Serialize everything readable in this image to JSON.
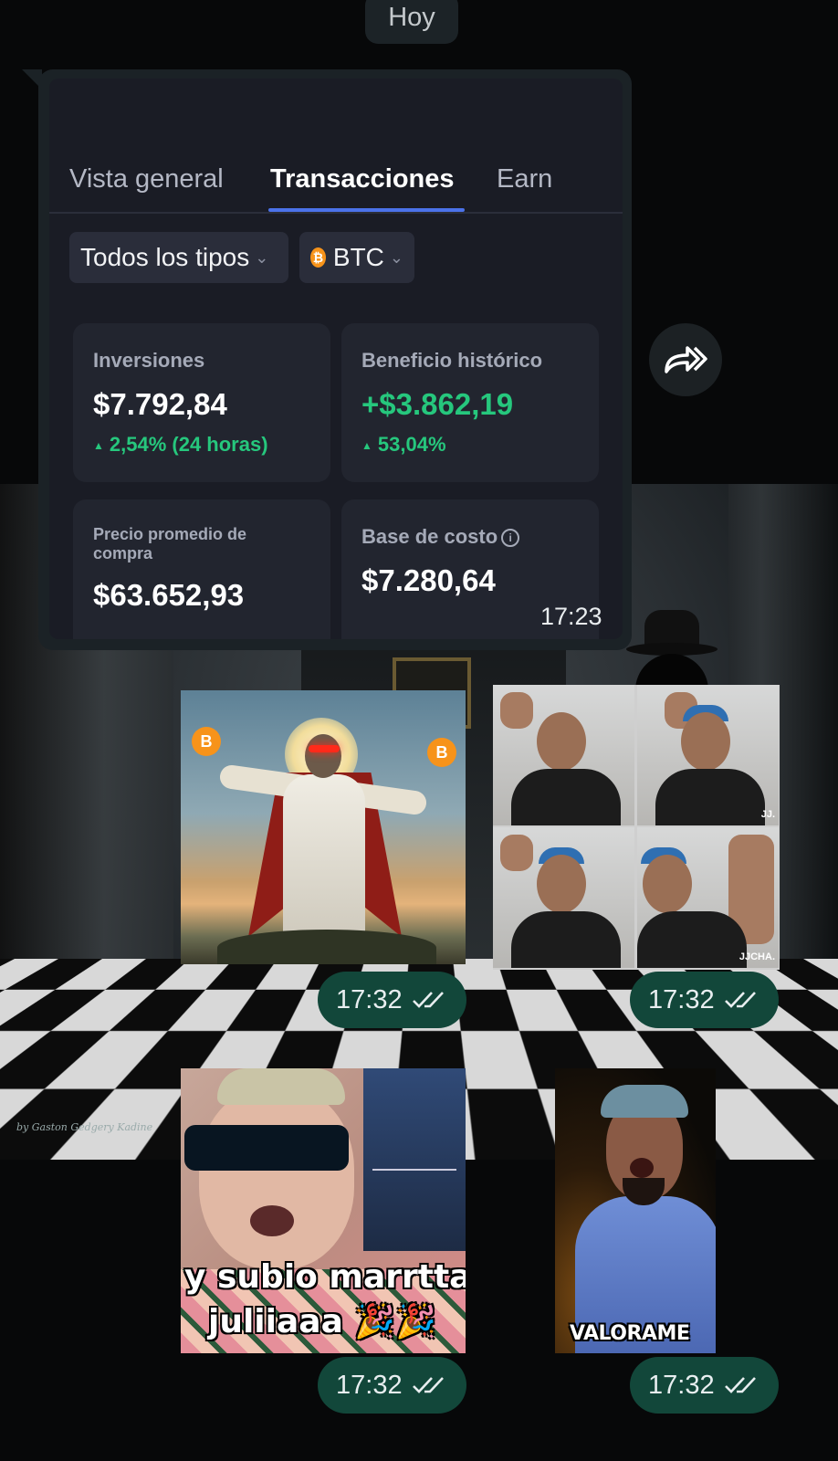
{
  "date_label": "Hoy",
  "screenshot": {
    "tabs": [
      "Vista general",
      "Transacciones",
      "Earn"
    ],
    "active_tab": "Transacciones",
    "filters": {
      "type": "Todos los tipos",
      "coin": "BTC",
      "coin_icon": "bitcoin-icon"
    },
    "cards": [
      {
        "label": "Inversiones",
        "value": "$7.792,84",
        "delta": "2,54% (24 horas)"
      },
      {
        "label": "Beneficio histórico",
        "value": "+$3.862,19",
        "delta": "53,04%"
      },
      {
        "label": "Precio promedio de compra",
        "value": "$63.652,93"
      },
      {
        "label": "Base de costo",
        "value": "$7.280,64",
        "icon": "info-icon"
      }
    ],
    "accent_color": "#4b72e9",
    "positive_color": "#26c77d"
  },
  "message1_time": "17:23",
  "media": [
    {
      "id": "btc-jesus-image",
      "time": "17:32",
      "coin_glyph": "B"
    },
    {
      "id": "fist-collage-image",
      "time": "17:32",
      "tags": [
        "JJ.",
        "JJCHA."
      ]
    },
    {
      "id": "sunglasses-video",
      "time": "17:32",
      "caption_line1": "y subio marrttaa",
      "caption_line2": "juliiaaa 🎉🎉"
    },
    {
      "id": "valorame-video",
      "time": "17:32",
      "caption": "VALORAME"
    }
  ],
  "wallpaper_signature": "by Gaston Gedgery Kadine",
  "status": {
    "read_color": "#e8eef0",
    "outgoing_bubble_color": "#12473a",
    "incoming_bubble_color": "#1b2226"
  }
}
